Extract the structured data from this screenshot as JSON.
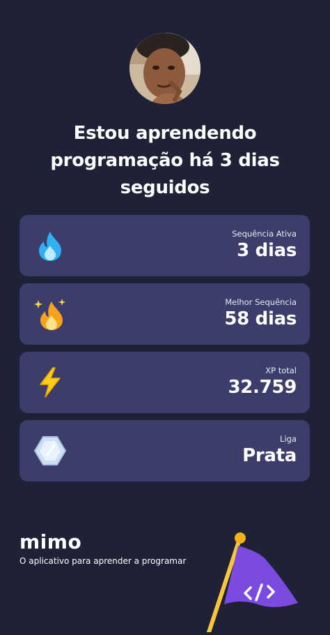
{
  "headline": "Estou aprendendo programação há 3 dias seguidos",
  "stats": [
    {
      "label": "Sequência Ativa",
      "value": "3 dias",
      "icon": "water-drop-flame-icon"
    },
    {
      "label": "Melhor Sequência",
      "value": "58 dias",
      "icon": "fire-sparkle-icon"
    },
    {
      "label": "XP total",
      "value": "32.759",
      "icon": "lightning-bolt-icon"
    },
    {
      "label": "Liga",
      "value": "Prata",
      "icon": "silver-gem-icon"
    }
  ],
  "brand": {
    "name": "mimo",
    "tagline": "O aplicativo para aprender a programar"
  },
  "colors": {
    "background": "#1f2136",
    "card": "#3c3d6b",
    "flag": "#7b4be0",
    "pole": "#f6c73d"
  }
}
